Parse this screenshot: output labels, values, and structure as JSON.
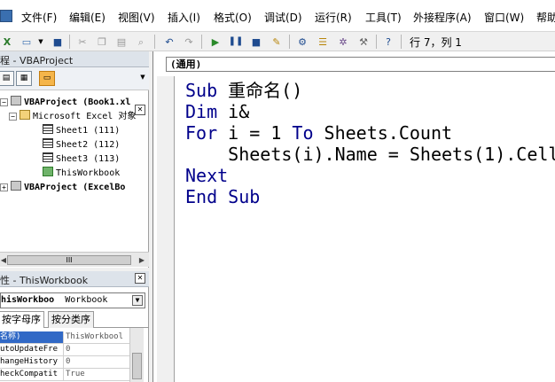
{
  "menubar": {
    "items": [
      "文件(F)",
      "编辑(E)",
      "视图(V)",
      "插入(I)",
      "格式(O)",
      "调试(D)",
      "运行(R)",
      "工具(T)",
      "外接程序(A)",
      "窗口(W)",
      "帮助"
    ]
  },
  "toolbar": {
    "cursor_position": "行 7，列 1"
  },
  "project_pane": {
    "title": "程 - VBAProject",
    "tree": [
      {
        "label": "VBAProject (Book1.xl",
        "bold": true,
        "icon": "vba-project-icon"
      },
      {
        "label": "Microsoft Excel 对象",
        "icon": "folder-icon"
      },
      {
        "label": "Sheet1 (111)",
        "icon": "sheet-icon"
      },
      {
        "label": "Sheet2 (112)",
        "icon": "sheet-icon"
      },
      {
        "label": "Sheet3 (113)",
        "icon": "sheet-icon"
      },
      {
        "label": "ThisWorkbook",
        "icon": "workbook-icon"
      },
      {
        "label": "VBAProject (ExcelBo",
        "bold": true,
        "icon": "vba-project-icon"
      }
    ],
    "scroll_label": "III"
  },
  "properties_pane": {
    "title": "性 - ThisWorkbook",
    "object_name": "hisWorkboo",
    "object_type": "Workbook",
    "tabs": [
      "按字母序",
      "按分类序"
    ],
    "rows": [
      {
        "name": "名称)",
        "value": "ThisWorkbool"
      },
      {
        "name": "utoUpdateFre",
        "value": "0"
      },
      {
        "name": "hangeHistory",
        "value": "0"
      },
      {
        "name": "heckCompatit",
        "value": "True"
      }
    ]
  },
  "code_window": {
    "procedure": "(通用)",
    "lines": [
      [
        {
          "t": "Sub",
          "k": true
        },
        {
          "t": " 重命名()",
          "k": false
        }
      ],
      [
        {
          "t": "Dim",
          "k": true
        },
        {
          "t": " i&",
          "k": false
        }
      ],
      [
        {
          "t": "For",
          "k": true
        },
        {
          "t": " i = 1 ",
          "k": false
        },
        {
          "t": "To",
          "k": true
        },
        {
          "t": " Sheets.Count",
          "k": false
        }
      ],
      [
        {
          "t": "    Sheets(i).Name = Sheets(1).Cell",
          "k": false
        }
      ],
      [
        {
          "t": "Next",
          "k": true
        }
      ],
      [
        {
          "t": "End Sub",
          "k": true
        }
      ]
    ]
  },
  "colors": {
    "keyword": "#00008b",
    "selection": "#3169c6",
    "active_tool": "#f5b54a"
  }
}
